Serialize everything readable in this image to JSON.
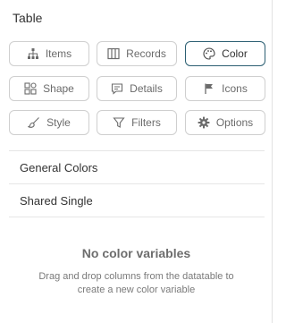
{
  "panel": {
    "title": "Table"
  },
  "buttons": [
    {
      "label": "Items",
      "icon": "hierarchy-icon"
    },
    {
      "label": "Records",
      "icon": "columns-icon"
    },
    {
      "label": "Color",
      "icon": "palette-icon",
      "active": true
    },
    {
      "label": "Shape",
      "icon": "shapes-icon"
    },
    {
      "label": "Details",
      "icon": "comment-icon"
    },
    {
      "label": "Icons",
      "icon": "flag-icon"
    },
    {
      "label": "Style",
      "icon": "brush-icon"
    },
    {
      "label": "Filters",
      "icon": "filter-icon"
    },
    {
      "label": "Options",
      "icon": "gear-icon"
    }
  ],
  "sections": [
    {
      "label": "General Colors"
    },
    {
      "label": "Shared Single"
    }
  ],
  "empty_state": {
    "title": "No color variables",
    "description": "Drag and drop columns from the datatable to create a new color variable"
  },
  "colors": {
    "active_border": "#2c5f72",
    "border": "#cfcfcf",
    "text_muted": "#6b6b6b"
  }
}
